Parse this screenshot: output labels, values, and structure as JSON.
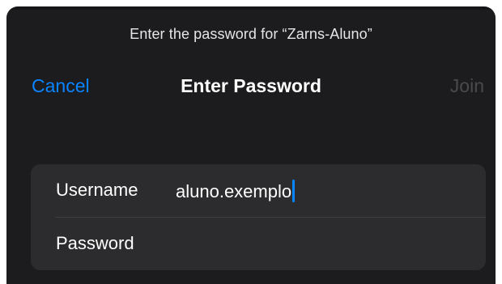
{
  "prompt": "Enter the password for “Zarns-Aluno”",
  "nav": {
    "cancel_label": "Cancel",
    "title": "Enter Password",
    "join_label": "Join"
  },
  "form": {
    "username_label": "Username",
    "username_value": "aluno.exemplo",
    "password_label": "Password",
    "password_value": ""
  },
  "colors": {
    "accent": "#0a84ff",
    "sheet_background": "#1c1c1e",
    "form_background": "#2c2c2e",
    "disabled_text": "#4a4a4d"
  }
}
